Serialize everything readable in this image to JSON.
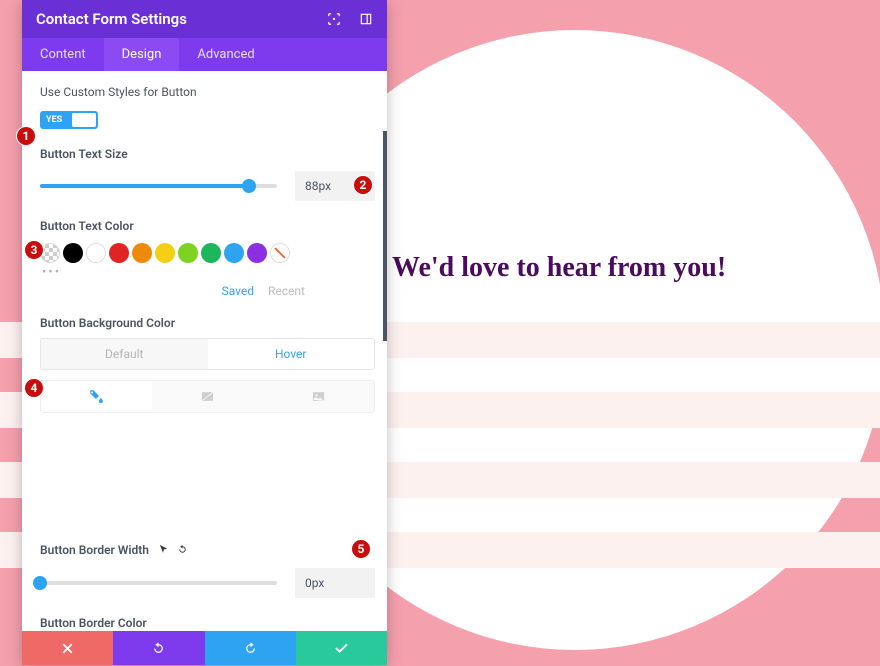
{
  "preview": {
    "headline": "We'd love to hear from you!"
  },
  "panel": {
    "title": "Contact Form Settings",
    "tabs": [
      "Content",
      "Design",
      "Advanced"
    ],
    "active_tab": 1
  },
  "fields": {
    "use_custom_styles_label": "Use Custom Styles for Button",
    "toggle_yes": "YES",
    "text_size_label": "Button Text Size",
    "text_size_value": "88px",
    "text_size_fill_pct": 88,
    "text_color_label": "Button Text Color",
    "swatch_tab_saved": "Saved",
    "swatch_tab_recent": "Recent",
    "bg_color_label": "Button Background Color",
    "dh_default": "Default",
    "dh_hover": "Hover",
    "border_width_label": "Button Border Width",
    "border_width_value": "0px",
    "border_width_fill_pct": 0,
    "border_color_label": "Button Border Color"
  },
  "swatches": {
    "text_color": [
      "transparent",
      "#000000",
      "#ffffff",
      "#e02424",
      "#ed8a0a",
      "#f4d014",
      "#7ed321",
      "#1cb65d",
      "#2ea3f2",
      "#8b2fe0",
      "slash"
    ],
    "border_color": [
      "picker",
      "#000000",
      "#ffffff",
      "#e02424",
      "#ed8a0a",
      "#f4d014",
      "#7ed321",
      "#1cb65d",
      "#2ea3f2",
      "#8b2fe0",
      "slash"
    ]
  },
  "callouts": [
    "1",
    "2",
    "3",
    "4",
    "5"
  ]
}
